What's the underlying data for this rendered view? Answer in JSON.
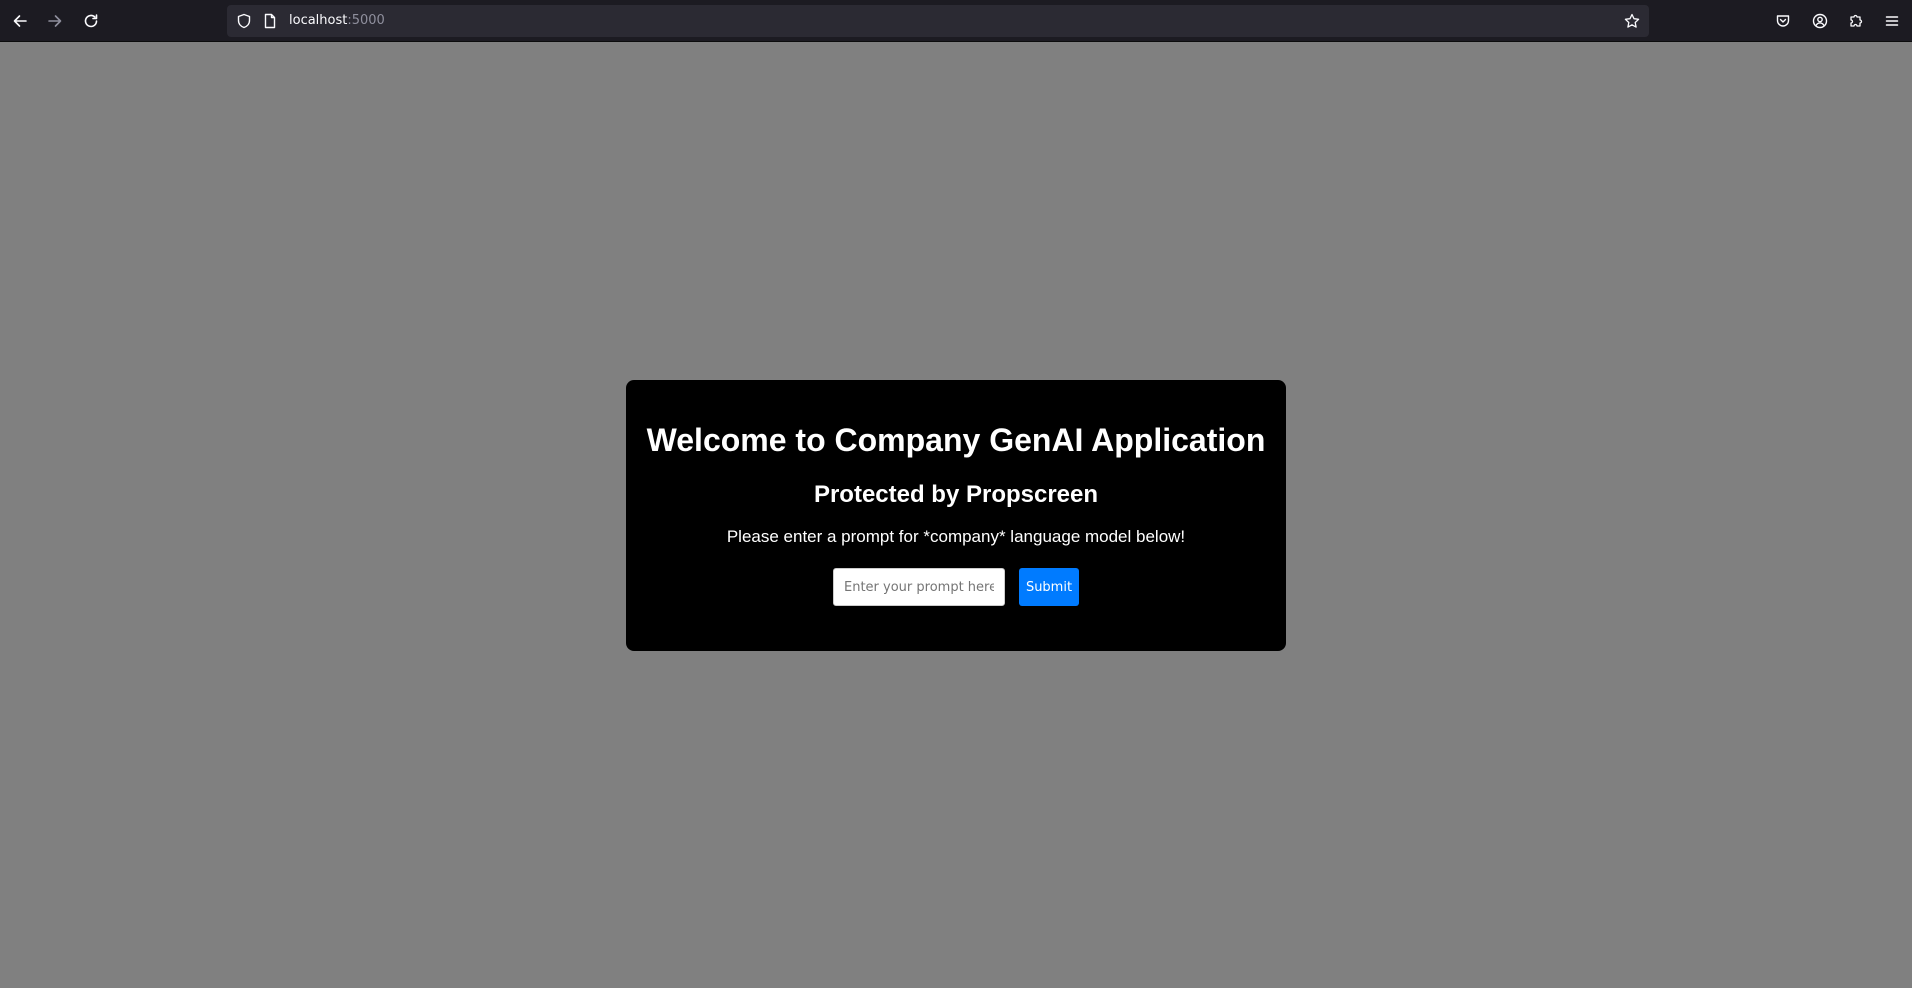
{
  "browser": {
    "url_host": "localhost",
    "url_port": ":5000",
    "icons": {
      "back": "arrow-left-icon",
      "forward": "arrow-right-icon",
      "reload": "reload-icon",
      "tracking": "shield-icon",
      "page": "page-icon",
      "bookmark": "star-icon",
      "pocket": "pocket-icon",
      "account": "account-icon",
      "extensions": "puzzle-icon",
      "menu": "hamburger-menu-icon"
    },
    "colors": {
      "toolbar_bg": "#1c1b22",
      "urlbar_bg": "#2b2a33"
    }
  },
  "page": {
    "background": "#808080",
    "card_background": "#000000",
    "title": "Welcome to Company GenAI Application",
    "subtitle": "Protected by Propscreen",
    "description": "Please enter a prompt for *company* language model below!",
    "prompt_input": {
      "placeholder": "Enter your prompt here",
      "value": ""
    },
    "submit_label": "Submit",
    "accent_color": "#007bff"
  }
}
